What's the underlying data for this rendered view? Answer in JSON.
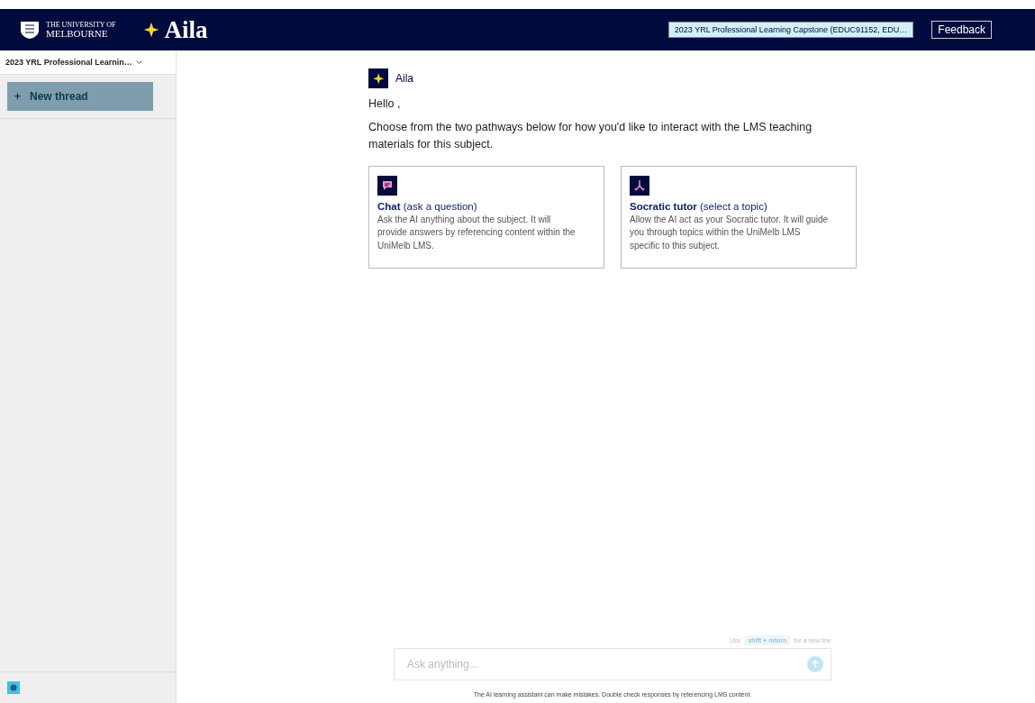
{
  "header": {
    "logo_top": "THE UNIVERSITY OF",
    "logo_bottom": "MELBOURNE",
    "app_name": "Aila",
    "subject_selector": "2023 YRL Professional Learning Capstone (EDUC91152, EDU…",
    "feedback_button": "Feedback"
  },
  "sidebar": {
    "subject": "2023 YRL Professional Learnin…",
    "new_thread": {
      "icon": "+",
      "label": "New thread"
    }
  },
  "message": {
    "sender": "Aila",
    "greeting": "Hello ,",
    "intro": "Choose from the two pathways below for how you'd like to interact with the LMS teaching materials for this subject."
  },
  "pathways": [
    {
      "kind": "chat",
      "title": "**Chat** (ask a question)",
      "description": "Ask the AI anything about the subject. It will provide answers by referencing content within the UniMelb LMS."
    },
    {
      "kind": "tutor",
      "title": "**Socratic tutor** (select a topic)",
      "description": "Allow the AI act as your Socratic tutor. It will guide you through topics within the UniMelb LMS specific to this subject."
    }
  ],
  "composer": {
    "hint_before": "Use",
    "hint_key": "shift + return",
    "hint_after": "for a new line",
    "placeholder": "Ask anything...",
    "disclaimer": "The AI learning assistant can make mistakes. Double check responses by referencing LMS content."
  }
}
